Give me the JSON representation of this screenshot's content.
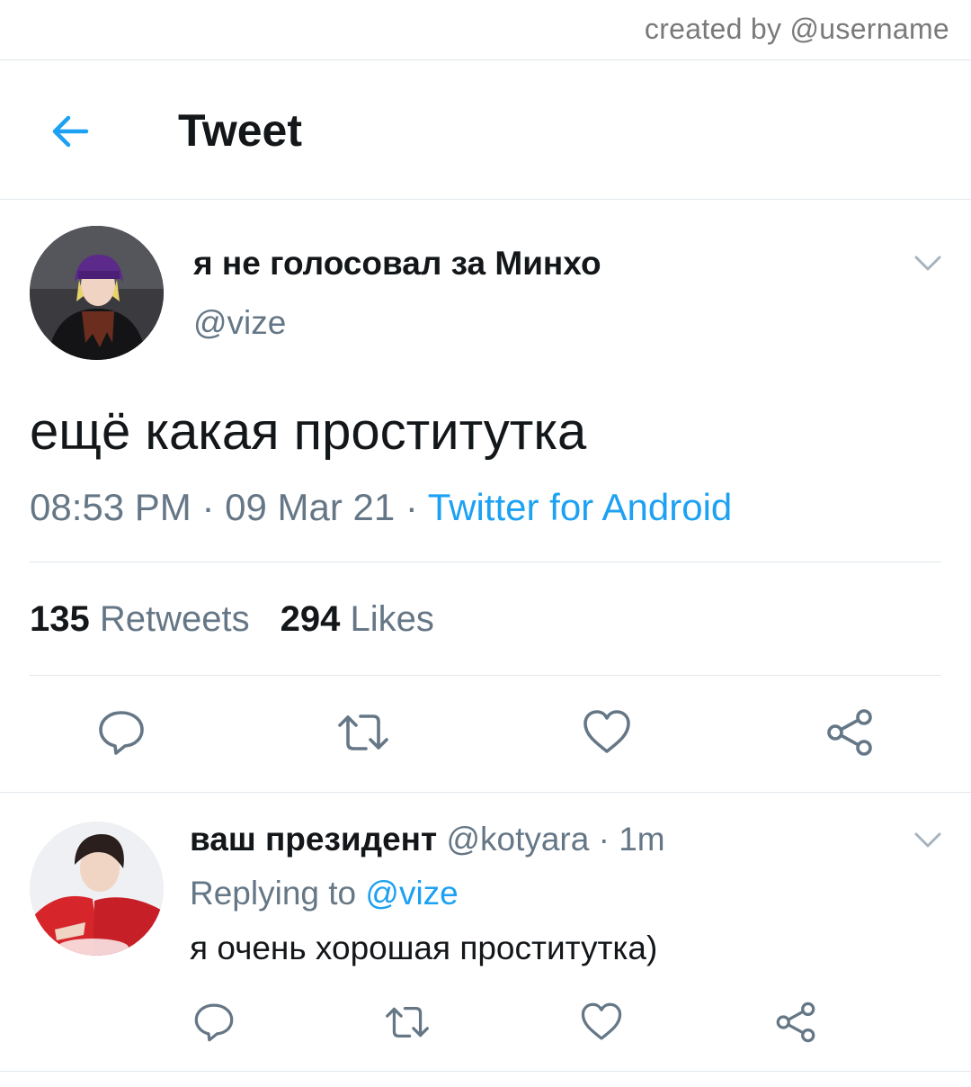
{
  "watermark": "created by @username",
  "header": {
    "title": "Tweet"
  },
  "tweet": {
    "display_name": "я не голосовал за Минхо",
    "handle": "@vize",
    "text": "ещё какая проститутка",
    "time": "08:53 PM",
    "date": "09 Mar 21",
    "source": "Twitter for Android",
    "sep": " · ",
    "retweets_count": "135",
    "retweets_label": "Retweets",
    "likes_count": "294",
    "likes_label": "Likes"
  },
  "reply": {
    "display_name": "ваш президент",
    "handle": "@kotyara",
    "time_ago": "1m",
    "replying_label": "Replying to",
    "replying_to": "@vize",
    "text": "я очень хорошая проститутка)"
  },
  "colors": {
    "accent": "#1da1f2",
    "muted": "#657786",
    "divider": "#e1e8ed"
  },
  "icons": [
    "back-arrow-icon",
    "chevron-down-icon",
    "reply-icon",
    "retweet-icon",
    "like-icon",
    "share-icon"
  ]
}
